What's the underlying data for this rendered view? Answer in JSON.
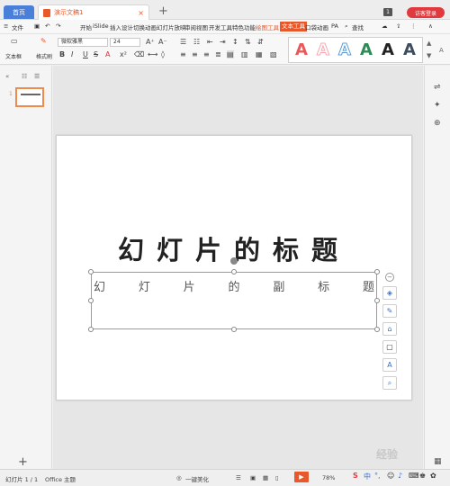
{
  "titlebar": {
    "home_tab": "首页",
    "doc_tab": "演示文稿1",
    "close": "×",
    "new_tab": "+",
    "badge": "1",
    "login_button": "访客登录"
  },
  "menubar": {
    "hamburger": "≡",
    "file_menu": "文件",
    "items": [
      "开始",
      "iSlide",
      "插入",
      "设计",
      "切换",
      "动画",
      "幻灯片放映",
      "审阅",
      "视图",
      "开发工具",
      "特色功能",
      "绘图工具",
      "文本工具",
      "口袋动画",
      "PA"
    ],
    "search": "查找"
  },
  "ribbon": {
    "textbox_label": "文本框",
    "format_brush_label": "格式刷",
    "font_name": "微软雅黑",
    "font_size": "24",
    "bold": "B",
    "italic": "I",
    "underline": "U",
    "strikethrough": "S",
    "font_color": "A",
    "increase_font": "A⁺",
    "decrease_font": "A⁻",
    "wordart_glyph": "A",
    "wordart_colors": [
      "#e85a5a",
      "#f6a8b0",
      "#5b9bd5",
      "#2e8b57",
      "#222222",
      "#3d4c5e"
    ]
  },
  "left_panel": {
    "slide_number": "1",
    "add_slide": "+"
  },
  "slide": {
    "title": "幻灯片的标题",
    "subtitle_chars": [
      "幻",
      "灯",
      "片",
      "的",
      "副",
      "标",
      "题"
    ]
  },
  "float_toolbar": {
    "collapse": "−",
    "icons": [
      "layers-icon",
      "pen-icon",
      "eraser-icon",
      "frame-icon",
      "text-icon",
      "find-replace-icon"
    ]
  },
  "statusbar": {
    "slide_counter": "幻灯片 1 / 1",
    "theme": "Office 主题",
    "beautify": "一键美化",
    "zoom": "78%",
    "ime_label": "中",
    "watermark": "经验"
  }
}
